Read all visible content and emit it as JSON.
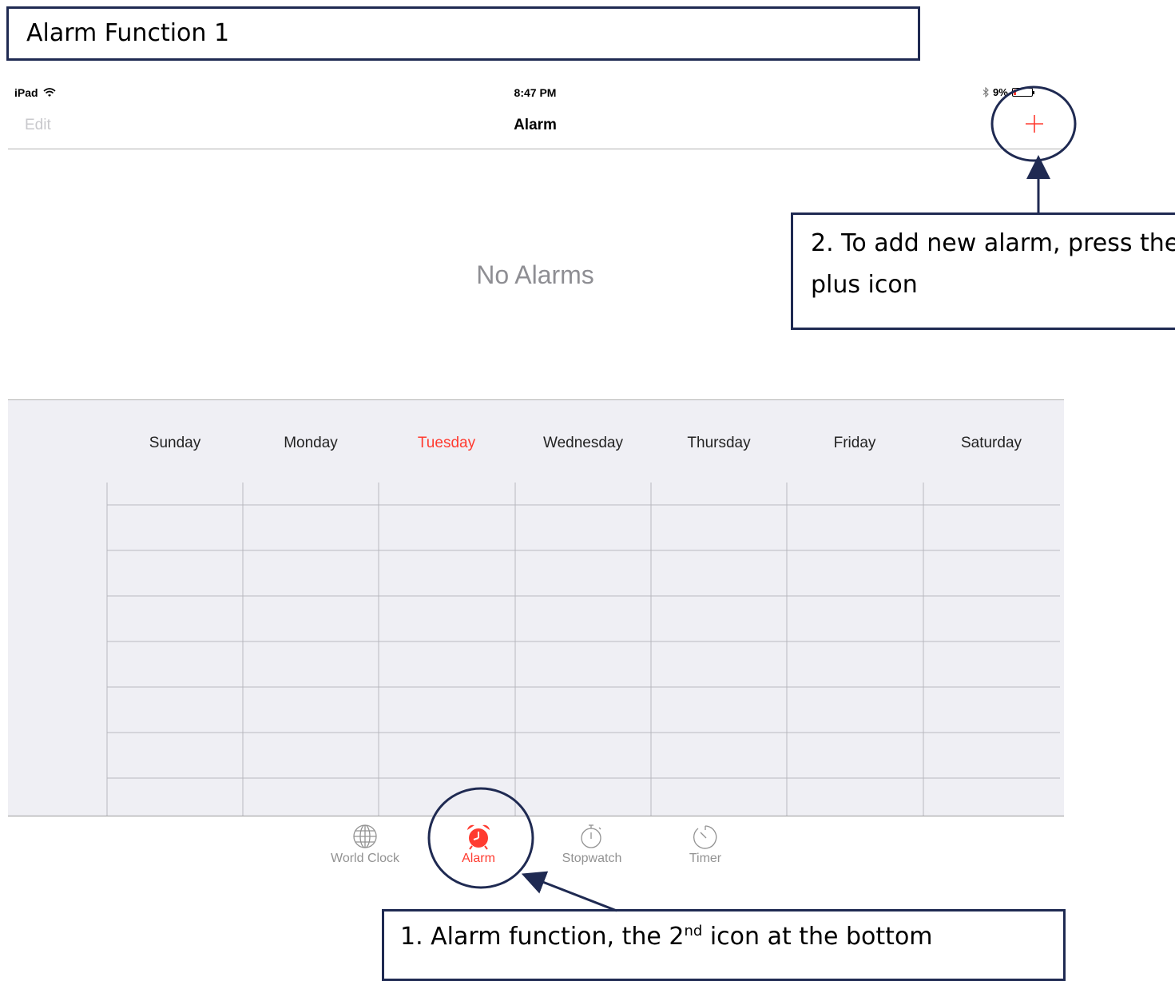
{
  "document": {
    "title": "Alarm Function 1"
  },
  "status_bar": {
    "device": "iPad",
    "time": "8:47 PM",
    "battery": "9%"
  },
  "nav_bar": {
    "edit_label": "Edit",
    "title": "Alarm",
    "add_label": "+"
  },
  "main": {
    "empty_text": "No Alarms"
  },
  "week": {
    "days": [
      "Sunday",
      "Monday",
      "Tuesday",
      "Wednesday",
      "Thursday",
      "Friday",
      "Saturday"
    ],
    "current_day": "Tuesday"
  },
  "tabbar": {
    "items": [
      {
        "label": "World Clock",
        "icon": "globe-icon",
        "active": false
      },
      {
        "label": "Alarm",
        "icon": "alarm-clock-icon",
        "active": true
      },
      {
        "label": "Stopwatch",
        "icon": "stopwatch-icon",
        "active": false
      },
      {
        "label": "Timer",
        "icon": "timer-icon",
        "active": false
      }
    ]
  },
  "annotations": {
    "callout_add": "2. To add new alarm, press the plus icon",
    "callout_alarm_prefix": "1. Alarm function, the 2",
    "callout_alarm_sup": "nd",
    "callout_alarm_suffix": " icon at the bottom"
  },
  "colors": {
    "accent": "#ff3b30",
    "annotation": "#1f2a52",
    "panel": "#efeff4"
  }
}
